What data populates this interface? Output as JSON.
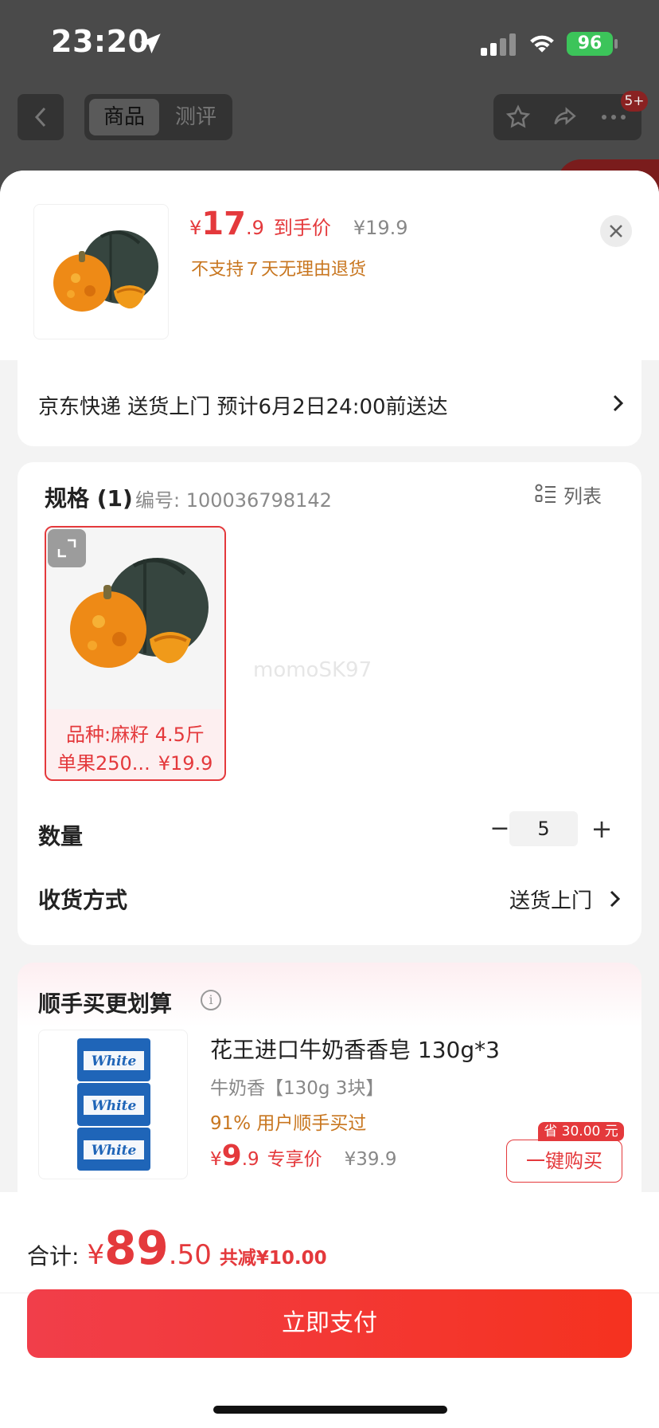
{
  "status_bar": {
    "time": "23:20",
    "battery": "96"
  },
  "top_nav": {
    "tabs": [
      {
        "label": "商品",
        "active": true
      },
      {
        "label": "测评",
        "active": false
      }
    ],
    "badge": "5+"
  },
  "sheet": {
    "price": {
      "currency": "¥",
      "integer": "17",
      "decimal": ".9",
      "tag": "到手价",
      "original": "¥19.9"
    },
    "return_policy": "不支持７天无理由退货",
    "delivery": "京东快递 送货上门 预计6月2日24:00前送达",
    "spec": {
      "title": "规格 (1)",
      "code": "编号: 100036798142",
      "view_mode": "列表",
      "sku": {
        "line1": "品种:麻籽 4.5斤",
        "line2": "单果250...",
        "price": "¥19.9"
      },
      "watermark": "momoSK97"
    },
    "quantity": {
      "label": "数量",
      "value": "5"
    },
    "receive": {
      "label": "收货方式",
      "value": "送货上门"
    },
    "bundle": {
      "title": "顺手买更划算",
      "product_name": "花王进口牛奶香香皂 130g*3",
      "variant": "牛奶香【130g 3块】",
      "rate": "91% 用户顺手买过",
      "price_currency": "¥",
      "price_integer": "9",
      "price_decimal": ".9",
      "price_tag": "专享价",
      "price_original": "¥39.9",
      "save_badge": "省 30.00 元",
      "buy_button": "一键购买",
      "soap_brand": "White"
    },
    "footer": {
      "total_label": "合计:",
      "total_currency": "¥",
      "total_integer": "89",
      "total_decimal": ".50",
      "discount": "共减¥10.00",
      "pay_button": "立即支付"
    }
  },
  "colors": {
    "accent": "#e4393c",
    "warning": "#c8761f",
    "battery": "#3cc45a"
  }
}
